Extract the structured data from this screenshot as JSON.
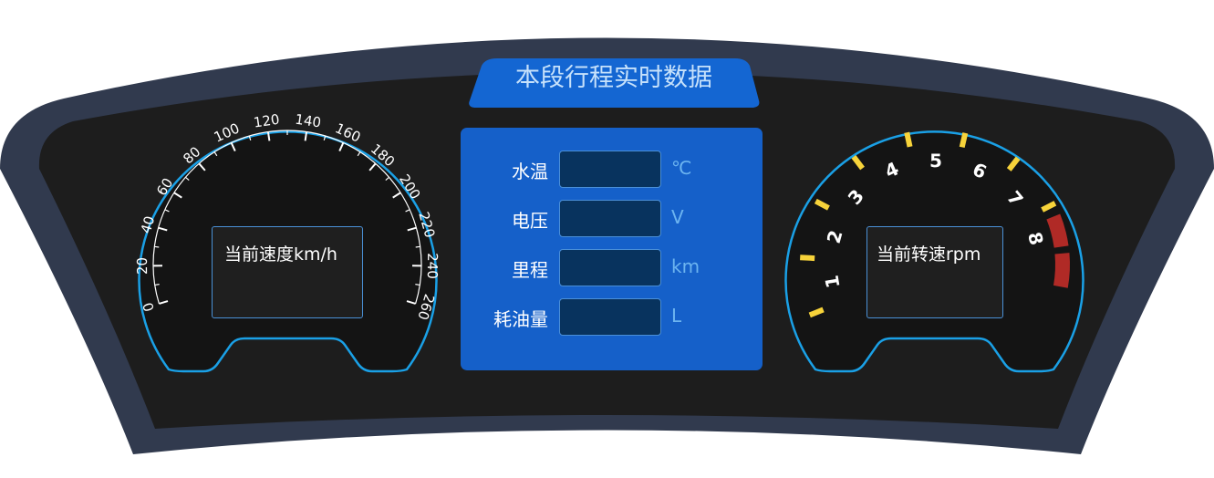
{
  "title": "本段行程实时数据",
  "speedometer": {
    "label": "当前速度km/h",
    "ticks": [
      "0",
      "20",
      "40",
      "60",
      "80",
      "100",
      "120",
      "140",
      "160",
      "180",
      "200",
      "220",
      "240",
      "260"
    ]
  },
  "tachometer": {
    "label": "当前转速rpm",
    "ticks": [
      "1",
      "2",
      "3",
      "4",
      "5",
      "6",
      "7",
      "8"
    ]
  },
  "trip_panel": {
    "rows": [
      {
        "label": "水温",
        "value": "",
        "unit": "℃"
      },
      {
        "label": "电压",
        "value": "",
        "unit": "V"
      },
      {
        "label": "里程",
        "value": "",
        "unit": "km"
      },
      {
        "label": "耗油量",
        "value": "",
        "unit": "L"
      }
    ]
  },
  "colors": {
    "frame": "#313a4e",
    "face": "#1d1d1d",
    "gauge_ring": "#1aa0e6",
    "panel": "#1560c9",
    "title_tab": "#1466d2",
    "tach_tick": "#f7d33a",
    "redline": "#b02a26"
  }
}
